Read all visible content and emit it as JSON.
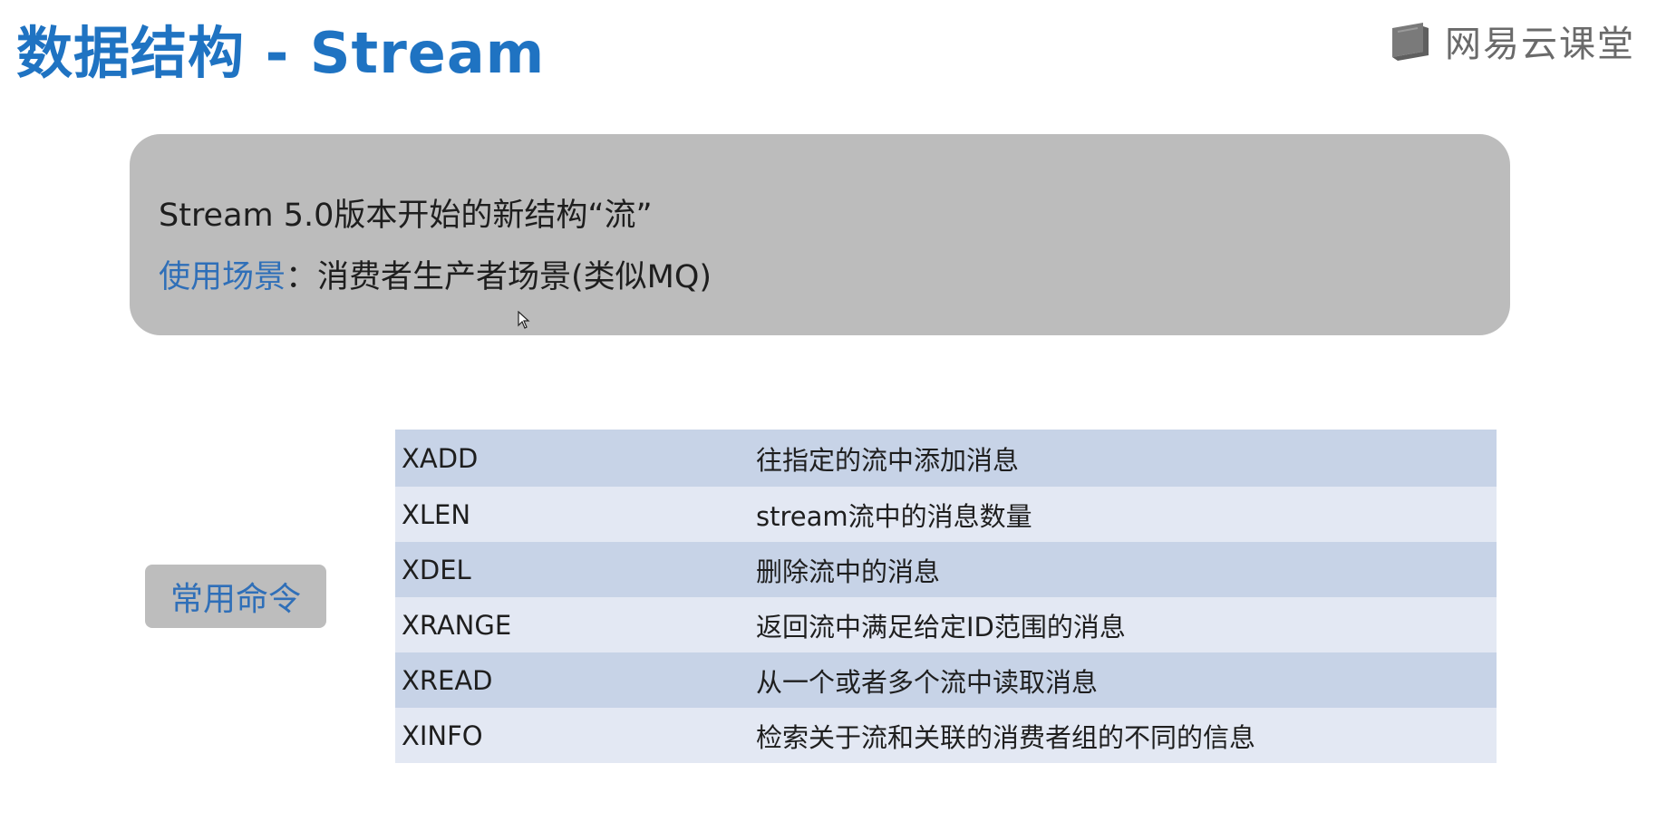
{
  "slide": {
    "title": "数据结构 - Stream"
  },
  "brand": {
    "logo_icon": "book-icon",
    "name": "网易云课堂"
  },
  "intro": {
    "line1": "Stream 5.0版本开始的新结构“流”",
    "usage_label": "使用场景",
    "usage_separator": "：",
    "usage_text": "消费者生产者场景(类似MQ)"
  },
  "badge": {
    "label": "常用命令"
  },
  "commands": [
    {
      "name": "XADD",
      "desc": "往指定的流中添加消息"
    },
    {
      "name": "XLEN",
      "desc": "stream流中的消息数量"
    },
    {
      "name": "XDEL",
      "desc": "删除流中的消息"
    },
    {
      "name": "XRANGE",
      "desc": "返回流中满足给定ID范围的消息"
    },
    {
      "name": "XREAD",
      "desc": "从一个或者多个流中读取消息"
    },
    {
      "name": "XINFO",
      "desc": "检索关于流和关联的消费者组的不同的信息"
    }
  ],
  "colors": {
    "title": "#1f73c2",
    "highlight": "#2f6fb8",
    "intro_bg": "#bcbcbc",
    "row_dark": "#c7d3e7",
    "row_light": "#e3e8f3"
  }
}
